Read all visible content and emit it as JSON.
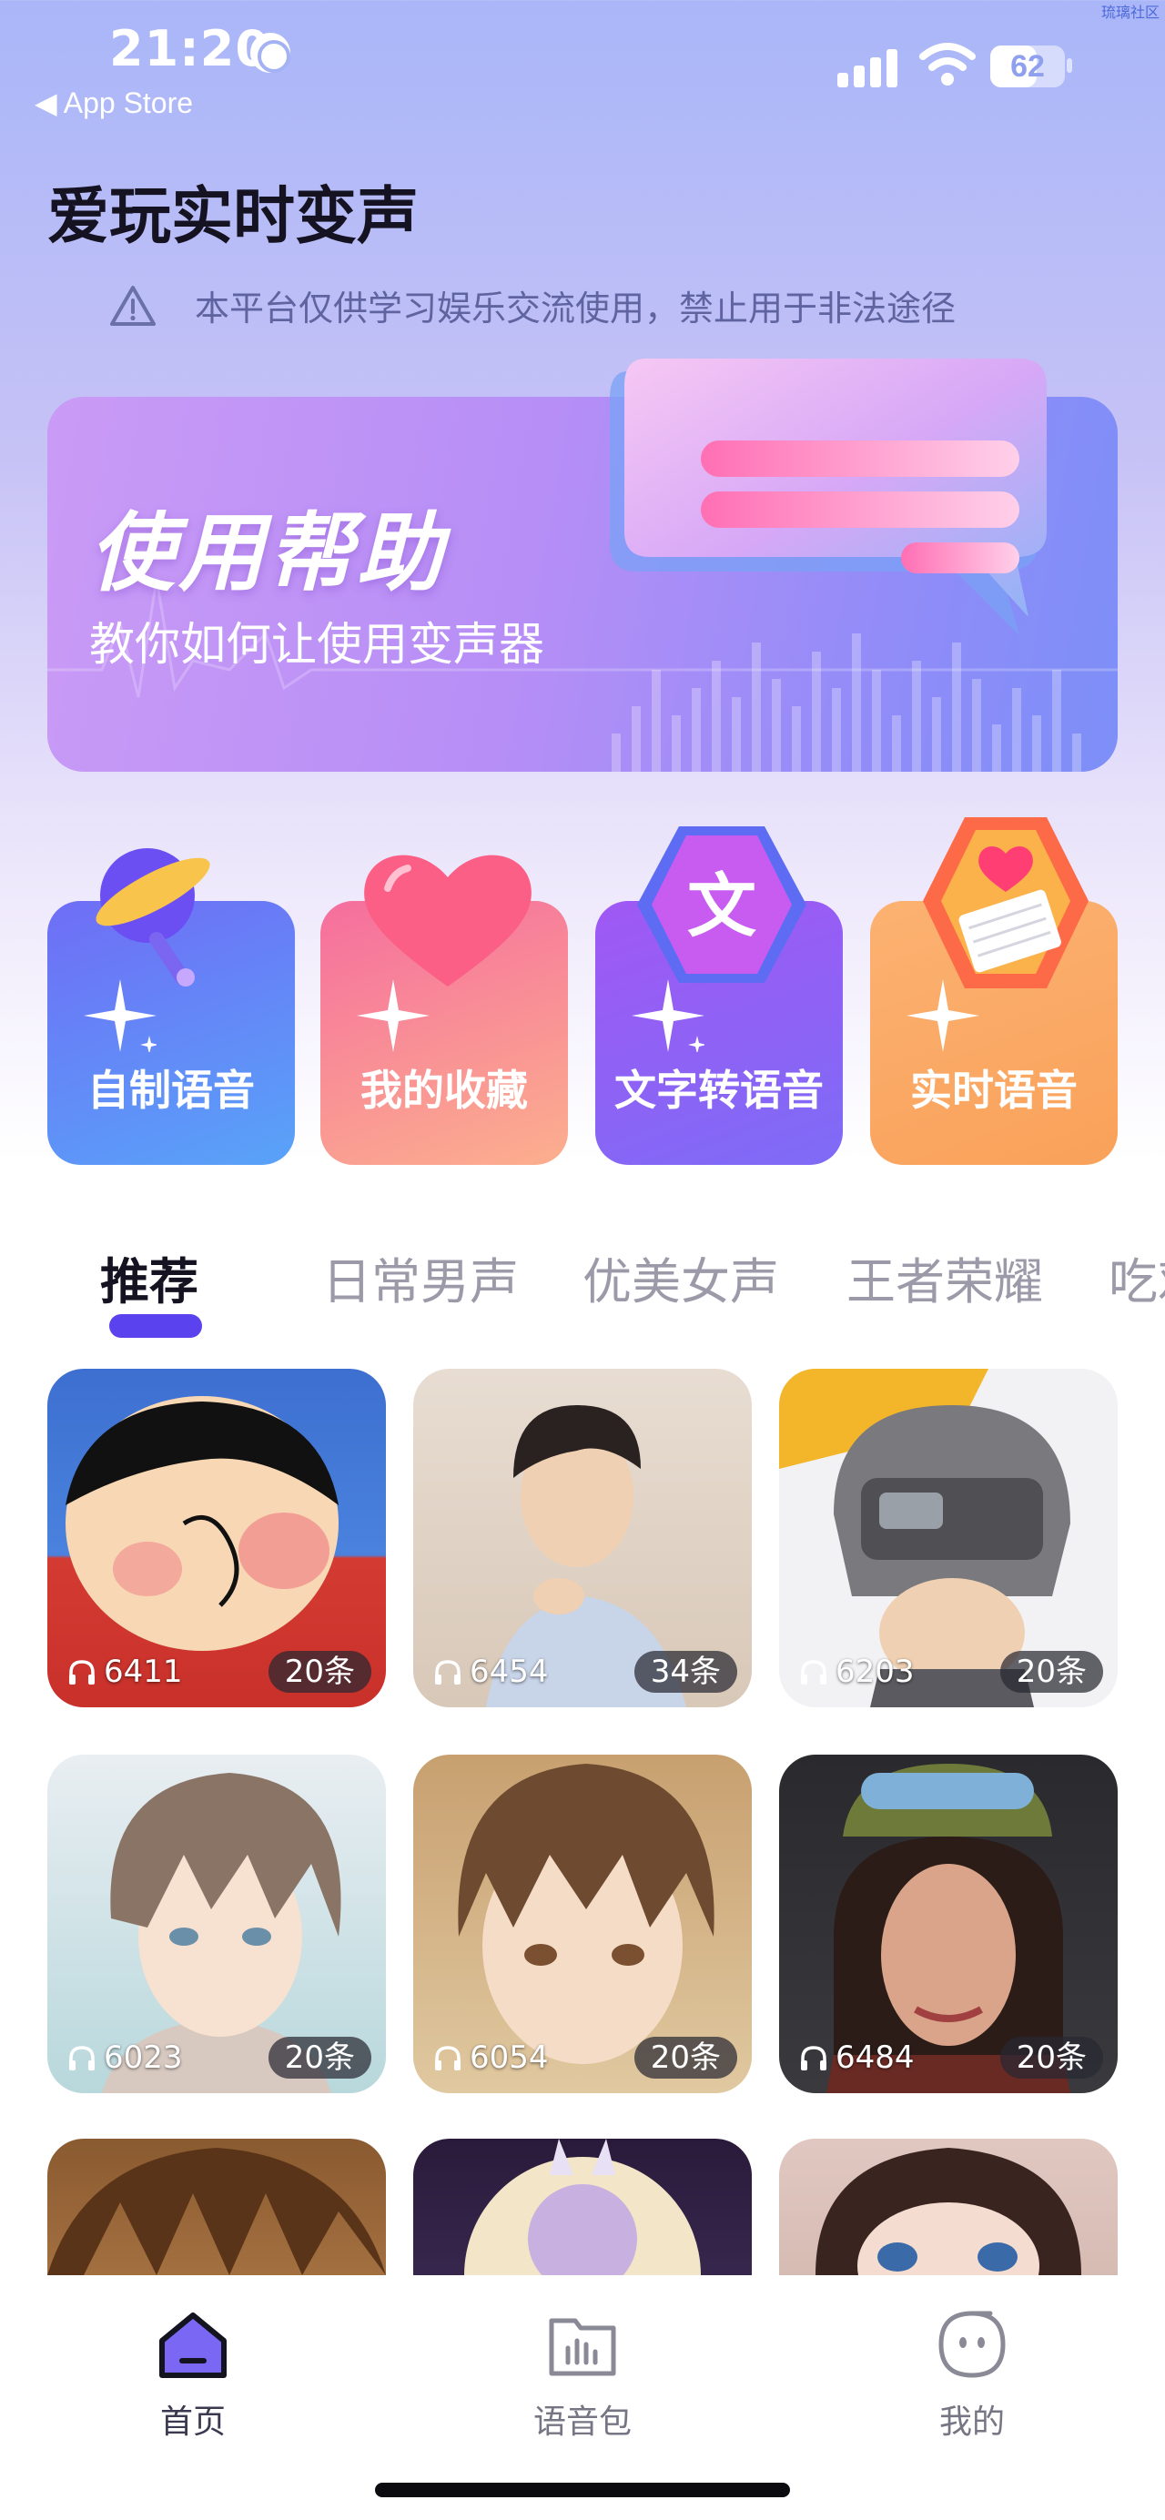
{
  "status_bar": {
    "time": "21:20",
    "back_app": "◀ App Store",
    "battery": "62",
    "battery_level": 0.62,
    "watermark": "琉璃社区"
  },
  "header": {
    "title": "爱玩实时变声",
    "disclaimer": "本平台仅供学习娱乐交流使用，禁止用于非法途径"
  },
  "banner": {
    "title": "使用帮助",
    "subtitle": "教你如何让使用变声器"
  },
  "features": [
    {
      "label": "自制语音",
      "icon": "microphone-icon"
    },
    {
      "label": "我的收藏",
      "icon": "heart-icon"
    },
    {
      "label": "文字转语音",
      "icon": "text-hexagon-icon",
      "glyph": "文"
    },
    {
      "label": "实时语音",
      "icon": "heart-keyboard-icon"
    }
  ],
  "tabs": [
    "推荐",
    "日常男声",
    "优美女声",
    "王者荣耀",
    "吃鸡"
  ],
  "tiles": [
    {
      "plays": "6411",
      "count": "20条"
    },
    {
      "plays": "6454",
      "count": "34条"
    },
    {
      "plays": "6203",
      "count": "20条"
    },
    {
      "plays": "6023",
      "count": "20条"
    },
    {
      "plays": "6054",
      "count": "20条"
    },
    {
      "plays": "6484",
      "count": "20条"
    },
    {
      "plays": "",
      "count": ""
    },
    {
      "plays": "",
      "count": ""
    },
    {
      "plays": "",
      "count": ""
    }
  ],
  "nav": [
    {
      "label": "首页",
      "icon": "home-icon"
    },
    {
      "label": "语音包",
      "icon": "voice-pack-icon"
    },
    {
      "label": "我的",
      "icon": "profile-face-icon"
    }
  ],
  "colors": {
    "accent": "#5a43ee",
    "text_primary": "#151321",
    "tab_inactive": "#9c9aa8"
  }
}
